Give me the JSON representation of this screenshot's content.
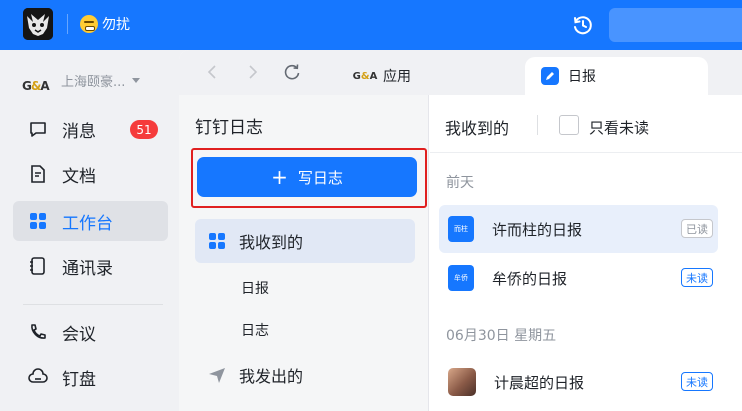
{
  "topbar": {
    "status_label": "勿扰",
    "icons": {
      "logo": "app-logo",
      "dnd": "dnd-emoji-icon",
      "history": "history-icon"
    },
    "accent": "#1677ff"
  },
  "org": {
    "logo_text_1": "G",
    "logo_text_amp": "&",
    "logo_text_2": "A",
    "name": "上海颐豪..."
  },
  "nav": {
    "items": [
      {
        "label": "消息",
        "icon": "chat-icon",
        "badge": "51"
      },
      {
        "label": "文档",
        "icon": "document-icon"
      },
      {
        "label": "工作台",
        "icon": "workbench-icon",
        "active": true
      },
      {
        "label": "通讯录",
        "icon": "contacts-icon"
      },
      {
        "label": "会议",
        "icon": "meeting-phone-icon"
      },
      {
        "label": "钉盘",
        "icon": "cloud-disk-icon"
      }
    ]
  },
  "tabs": [
    {
      "label": "应用",
      "icon": "app-logo-small"
    },
    {
      "label": "日报",
      "icon": "daily-report-icon",
      "active": true
    }
  ],
  "journal": {
    "title": "钉钉日志",
    "write_button": "写日志",
    "write_plus": "+",
    "menu": [
      {
        "label": "我收到的",
        "icon": "grid-icon",
        "active": true
      },
      {
        "label": "我发出的",
        "icon": "send-icon"
      }
    ],
    "sub_items": [
      "日报",
      "日志"
    ]
  },
  "list": {
    "header": "我收到的",
    "filter_label": "只看未读",
    "groups": [
      {
        "label": "前天",
        "rows": [
          {
            "avatar_text": "而柱",
            "title": "许而柱的日报",
            "status": "已读",
            "read": true,
            "active": true
          },
          {
            "avatar_text": "牟侨",
            "title": "牟侨的日报",
            "status": "未读",
            "read": false
          }
        ]
      },
      {
        "label": "06月30日 星期五",
        "rows": [
          {
            "avatar_text": "",
            "title": "计晨超的日报",
            "status": "未读",
            "read": false,
            "photo": true
          }
        ]
      }
    ]
  }
}
